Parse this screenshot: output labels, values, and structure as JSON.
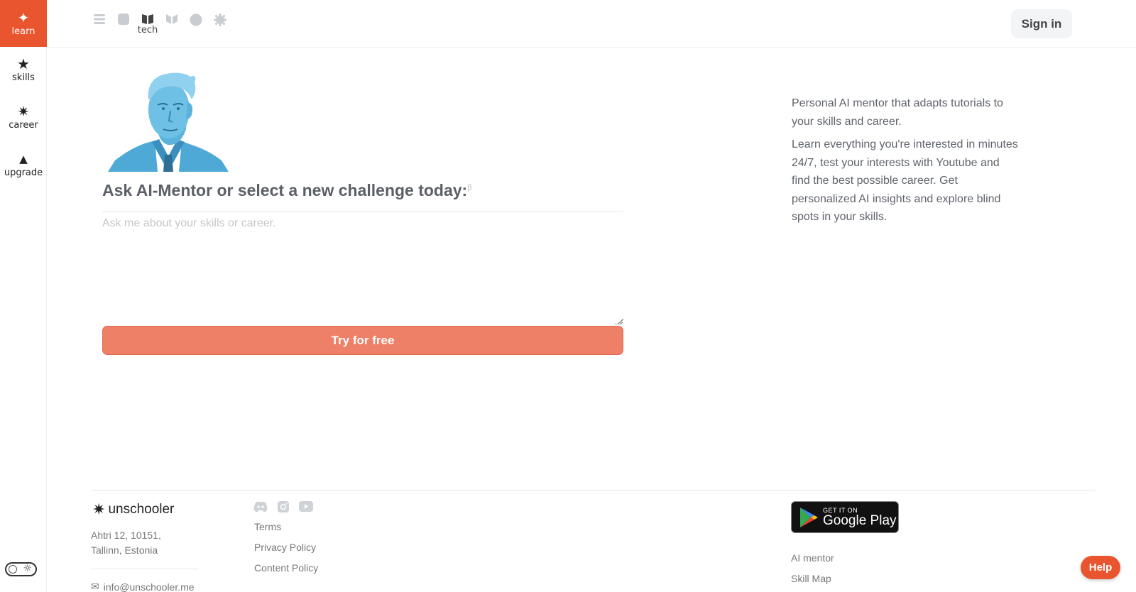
{
  "sidebar": {
    "items": [
      {
        "label": "learn",
        "icon": "sparkle-icon"
      },
      {
        "label": "skills",
        "icon": "star-icon"
      },
      {
        "label": "career",
        "icon": "starburst-icon"
      },
      {
        "label": "upgrade",
        "icon": "triangle-icon"
      }
    ]
  },
  "header": {
    "categories": [
      "layers-icon",
      "square-icon",
      "tech",
      "bookmark-icon",
      "circle-icon",
      "gear-icon"
    ],
    "active_category_label": "tech",
    "signin_label": "Sign in"
  },
  "main": {
    "headline": "Ask AI-Mentor or select a new challenge today:",
    "beta_mark": "β",
    "input_placeholder": "Ask me about your skills or career.",
    "cta_label": "Try for free"
  },
  "aside": {
    "paragraph1": "Personal AI mentor that adapts tutorials to your skills and career.",
    "paragraph2": "Learn everything you're interested in minutes 24/7, test your interests with Youtube and find the best possible career. Get personalized AI insights and explore blind spots in your skills."
  },
  "footer": {
    "brand": "unschooler",
    "address_line1": "Ahtri 12, 10151,",
    "address_line2": "Tallinn, Estonia",
    "email": "info@unschooler.me",
    "links": [
      "Terms",
      "Privacy Policy",
      "Content Policy"
    ],
    "store_small": "GET IT ON",
    "store_big": "Google Play",
    "links2": [
      "AI mentor",
      "Skill Map"
    ]
  },
  "help_label": "Help",
  "colors": {
    "accent": "#e8552f",
    "cta": "#ee8068",
    "portrait": "#4fa9d6"
  }
}
